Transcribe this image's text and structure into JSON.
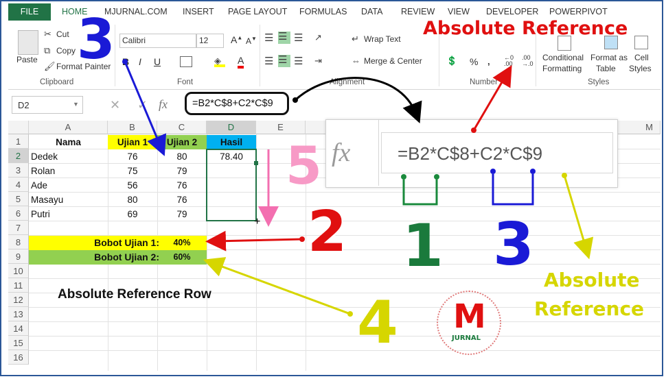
{
  "ribbon_tabs": [
    "FILE",
    "HOME",
    "MJURNAL.COM",
    "INSERT",
    "PAGE LAYOUT",
    "FORMULAS",
    "DATA",
    "REVIEW",
    "VIEW",
    "DEVELOPER",
    "POWERPIVOT"
  ],
  "clipboard": {
    "paste": "Paste",
    "cut": "Cut",
    "copy": "Copy",
    "format_painter": "Format Painter",
    "label": "Clipboard"
  },
  "font": {
    "name": "Calibri",
    "size": "12",
    "label": "Font"
  },
  "alignment": {
    "wrap": "Wrap Text",
    "merge": "Merge & Center",
    "label": "Alignment"
  },
  "number": {
    "label": "Number",
    "percent": "%"
  },
  "styles": {
    "conditional_1": "Conditional",
    "conditional_2": "Formatting",
    "format_as_1": "Format as",
    "format_as_2": "Table",
    "cell_1": "Cell",
    "cell_2": "Styles",
    "label": "Styles"
  },
  "formula_bar": {
    "name_box": "D2",
    "fx": "fx",
    "formula": "=B2*C$8+C2*C$9"
  },
  "columns": [
    "A",
    "B",
    "C",
    "D",
    "E",
    "M"
  ],
  "rows": [
    "1",
    "2",
    "3",
    "4",
    "5",
    "6",
    "7",
    "8",
    "9",
    "10",
    "11",
    "12",
    "13",
    "14",
    "15",
    "16"
  ],
  "table": {
    "headers": [
      "Nama",
      "Ujian 1",
      "Ujian 2",
      "Hasil"
    ],
    "data": [
      {
        "nama": "Dedek",
        "u1": "76",
        "u2": "80",
        "hasil": "78.40"
      },
      {
        "nama": "Rolan",
        "u1": "75",
        "u2": "79",
        "hasil": ""
      },
      {
        "nama": "Ade",
        "u1": "56",
        "u2": "76",
        "hasil": ""
      },
      {
        "nama": "Masayu",
        "u1": "80",
        "u2": "76",
        "hasil": ""
      },
      {
        "nama": "Putri",
        "u1": "69",
        "u2": "79",
        "hasil": ""
      }
    ]
  },
  "bobot": [
    {
      "label": "Bobot Ujian 1:",
      "value": "40%",
      "color": "#ffff00"
    },
    {
      "label": "Bobot Ujian 2:",
      "value": "60%",
      "color": "#92d050"
    }
  ],
  "annotation_row_title": "Absolute Reference Row",
  "zoom_formula": "=B2*C$8+C2*C$9",
  "callouts": {
    "absolute_reference_top": "Absolute Reference",
    "absolute_1": "Absolute",
    "absolute_2": "Reference",
    "n1": "1",
    "n2": "2",
    "n3_left": "3",
    "n3_right": "3",
    "n4": "4",
    "n5": "5"
  },
  "logo": {
    "letter": "M",
    "text": "JURNAL"
  },
  "colors": {
    "excel_green": "#217346",
    "header_yellow": "#ffff00",
    "header_green": "#92d050",
    "header_blue": "#00b0f0"
  }
}
